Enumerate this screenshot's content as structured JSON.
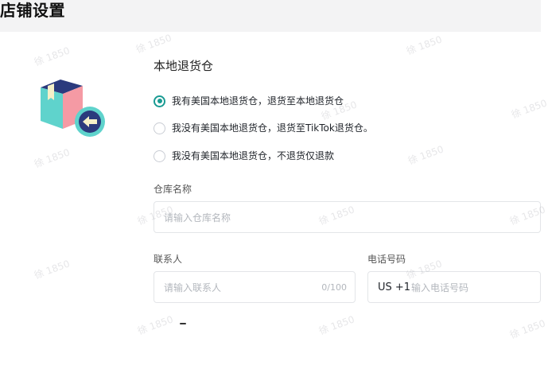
{
  "page": {
    "title": "店铺设置"
  },
  "section": {
    "title": "本地退货仓"
  },
  "return_options": [
    {
      "label": "我有美国本地退货仓，退货至本地退货仓",
      "selected": true
    },
    {
      "label": "我没有美国本地退货仓，退货至TikTok退货仓。",
      "selected": false
    },
    {
      "label": "我没有美国本地退货仓，不退货仅退款",
      "selected": false
    }
  ],
  "warehouse_name": {
    "label": "仓库名称",
    "placeholder": "请输入仓库名称",
    "value": ""
  },
  "contact": {
    "label": "联系人",
    "placeholder": "请输入联系人",
    "counter": "0/100",
    "value": ""
  },
  "phone": {
    "label": "电话号码",
    "country_code": "US +1",
    "placeholder": "输入电话号码",
    "value": ""
  },
  "watermark": {
    "text": "徐 1850"
  },
  "colors": {
    "accent": "#1a9b93",
    "header_bg": "#f3f3f4",
    "border": "#e3e5e8",
    "placeholder": "#b3b7bd"
  },
  "icons": {
    "illustration": "return-package-icon"
  }
}
